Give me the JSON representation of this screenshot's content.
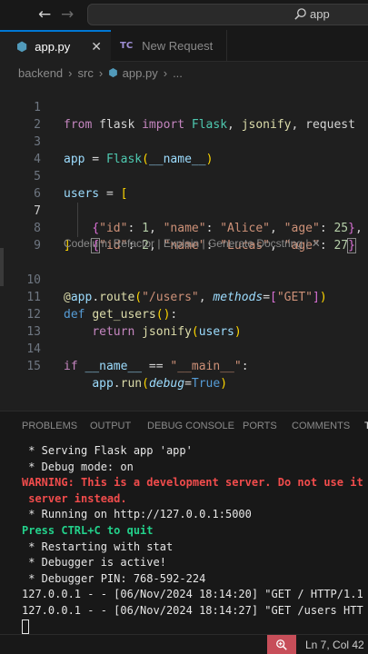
{
  "titlebar": {
    "back_arrow": "←",
    "forward_arrow": "→",
    "search_label": "app"
  },
  "tabs": [
    {
      "label": "app.py",
      "icon": "python-icon",
      "close": "✕"
    },
    {
      "label": "New Request",
      "icon_text": "TC"
    }
  ],
  "breadcrumb": {
    "items": [
      "backend",
      "src",
      "app.py",
      "..."
    ],
    "separator": "›"
  },
  "editor": {
    "line_numbers": [
      "1",
      "2",
      "3",
      "4",
      "5",
      "6",
      "7",
      "8",
      "9",
      "10",
      "11",
      "12",
      "13",
      "14",
      "15"
    ],
    "codelens": "Codeium: Refactor | Explain | Generate Docstring | ✕"
  },
  "panel": {
    "tabs": [
      "PROBLEMS",
      "OUTPUT",
      "DEBUG CONSOLE",
      "PORTS",
      "COMMENTS",
      "T"
    ],
    "terminal_lines": [
      " * Serving Flask app 'app'",
      " * Debug mode: on",
      "WARNING: This is a development server. Do not use it",
      " server instead.",
      " * Running on http://127.0.0.1:5000",
      "Press CTRL+C to quit",
      " * Restarting with stat",
      " * Debugger is active!",
      " * Debugger PIN: 768-592-224",
      "127.0.0.1 - - [06/Nov/2024 18:14:20] \"GET / HTTP/1.1",
      "127.0.0.1 - - [06/Nov/2024 18:14:27] \"GET /users HTT"
    ]
  },
  "statusbar": {
    "position": "Ln 7, Col 42"
  },
  "colors": {
    "accent": "#0078d4",
    "zoom_badge": "#c74e59",
    "warning": "#f14c4c",
    "ctrl_hint": "#23d18b"
  }
}
